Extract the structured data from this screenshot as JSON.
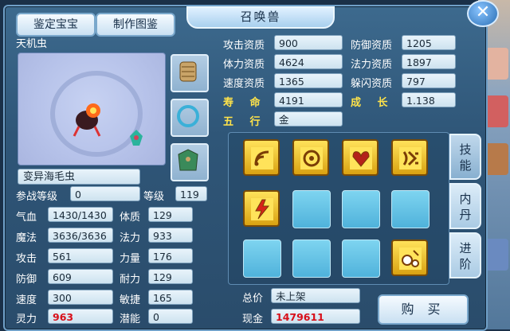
{
  "window_title": "召唤兽",
  "top_buttons": {
    "appraise": "鉴定宝宝",
    "make_map": "制作图鉴"
  },
  "pet": {
    "name": "天机虫",
    "variant_name": "变异海毛虫"
  },
  "aptitudes": {
    "attack_label": "攻击资质",
    "attack": "900",
    "defense_label": "防御资质",
    "defense": "1205",
    "stamina_label": "体力资质",
    "stamina": "4624",
    "magic_label": "法力资质",
    "magic": "1897",
    "speed_label": "速度资质",
    "speed": "1365",
    "dodge_label": "躲闪资质",
    "dodge": "797",
    "life_label": "寿  命",
    "life": "4191",
    "growth_label": "成  长",
    "growth": "1.138",
    "element_label": "五  行",
    "element": "金"
  },
  "stats": {
    "battle_level_label": "参战等级",
    "battle_level": "0",
    "level_label": "等级",
    "level": "119",
    "hp_label": "气血",
    "hp": "1430/1430",
    "physique_label": "体质",
    "physique": "129",
    "mp_label": "魔法",
    "mp": "3636/3636",
    "mana_label": "法力",
    "mana": "933",
    "atk_label": "攻击",
    "atk": "561",
    "strength_label": "力量",
    "strength": "176",
    "def_label": "防御",
    "def": "609",
    "endurance_label": "耐力",
    "endurance": "129",
    "spd_label": "速度",
    "spd": "300",
    "agility_label": "敏捷",
    "agility": "165",
    "spirit_label": "灵力",
    "spirit": "963",
    "potential_label": "潜能",
    "potential": "0"
  },
  "side_tabs": {
    "skills": "技能",
    "inner_pill": "内丹",
    "advance": "进阶"
  },
  "trade": {
    "price_label": "总价",
    "price": "未上架",
    "cash_label": "现金",
    "cash": "1479611",
    "buy_label": "购 买"
  },
  "skills": [
    {
      "icon": "signal-waves-icon"
    },
    {
      "icon": "eye-shield-icon"
    },
    {
      "icon": "heart-crest-icon"
    },
    {
      "icon": "rune-icon"
    },
    {
      "icon": "lightning-icon"
    },
    {
      "icon": "empty"
    },
    {
      "icon": "empty"
    },
    {
      "icon": "empty"
    },
    {
      "icon": "empty"
    },
    {
      "icon": "empty"
    },
    {
      "icon": "empty"
    },
    {
      "icon": "falling-rocks-icon"
    }
  ],
  "colors": {
    "accent_gold": "#ffe34a",
    "value_red": "#d8101a",
    "panel_blue": "#2f5678"
  }
}
